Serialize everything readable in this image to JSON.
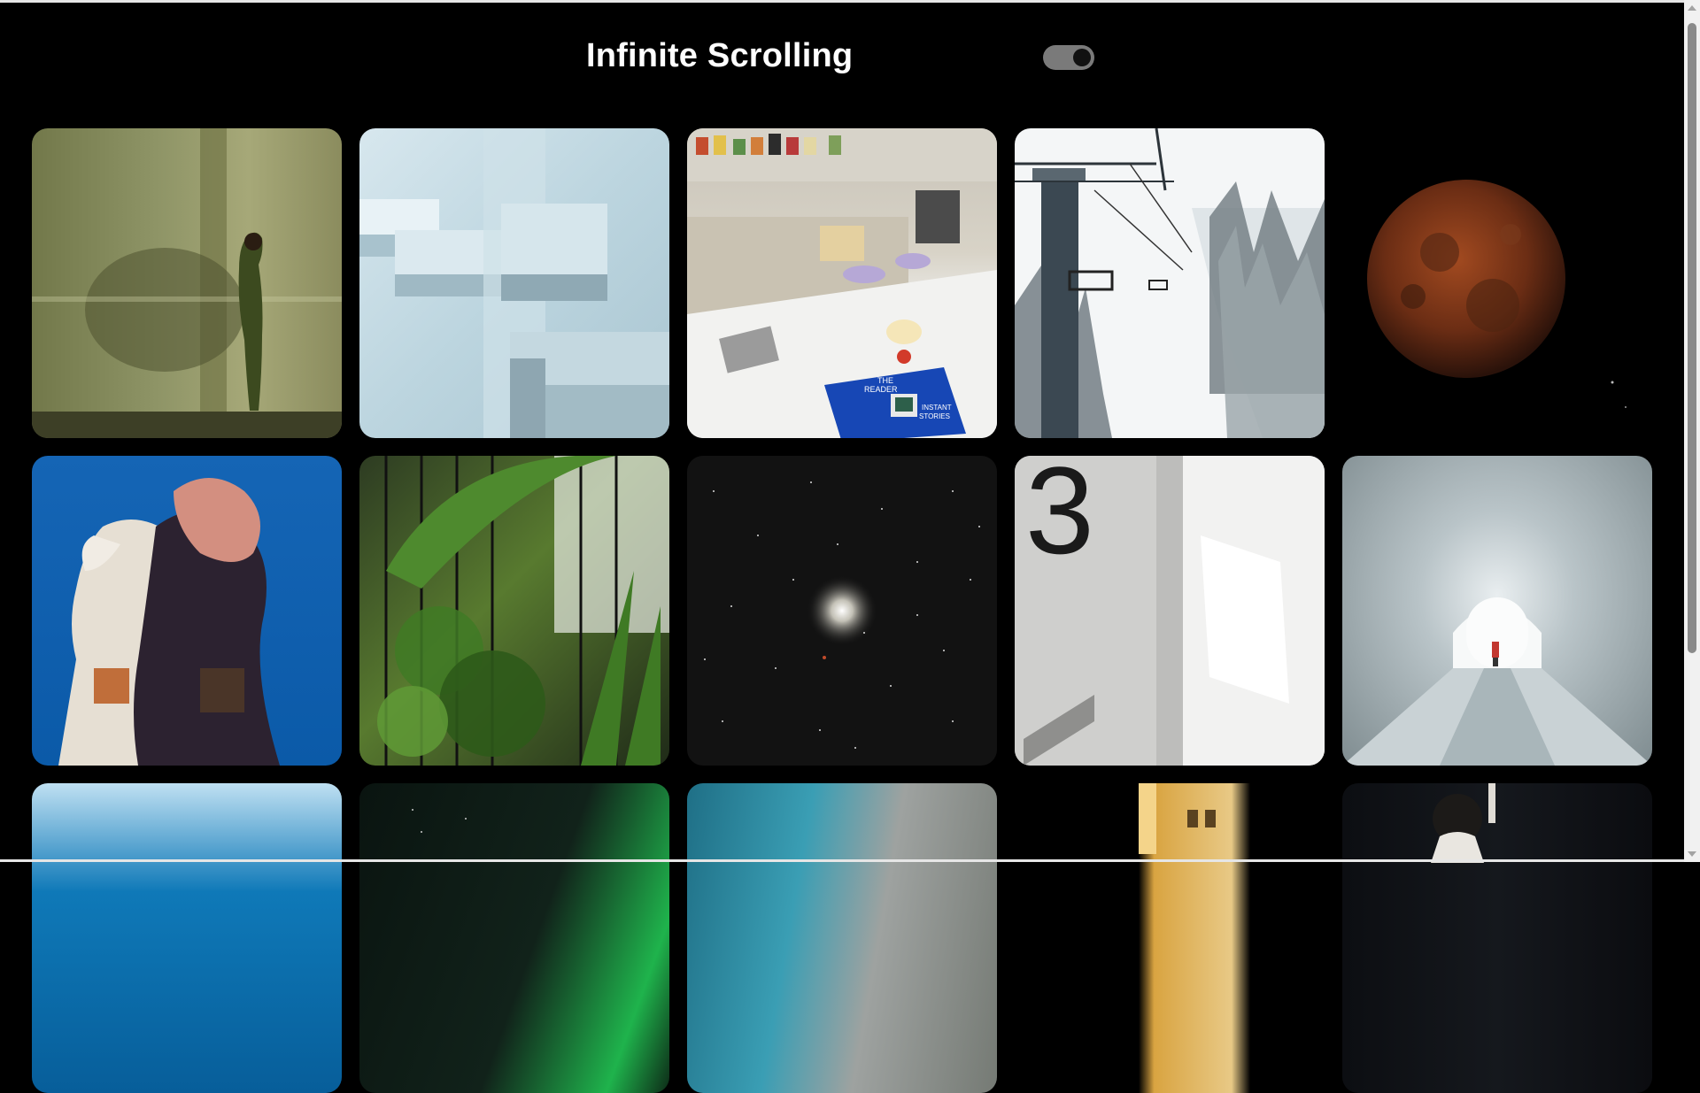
{
  "header": {
    "title": "Infinite Scrolling",
    "toggle_state": "on"
  },
  "gallery": {
    "columns": 5,
    "tiles": [
      {
        "subject": "woman-against-wall"
      },
      {
        "subject": "abstract-blue-architecture"
      },
      {
        "subject": "kitchen-counter-book"
      },
      {
        "subject": "ski-lift-snow-forest"
      },
      {
        "subject": "blood-moon"
      },
      {
        "subject": "person-with-horse"
      },
      {
        "subject": "tropical-plants-fence"
      },
      {
        "subject": "star-cluster"
      },
      {
        "subject": "wall-number-three"
      },
      {
        "subject": "tunnel-hallway"
      },
      {
        "subject": "ocean-horizon"
      },
      {
        "subject": "aurora-night-sky"
      },
      {
        "subject": "aerial-coastline"
      },
      {
        "subject": "theatre-marquee-night"
      },
      {
        "subject": "woman-portrait-dark"
      }
    ],
    "tile3_book_text": [
      "THE",
      "READER",
      "INSTANT",
      "STORIES"
    ],
    "tile9_number": "3"
  },
  "scrollbar": {
    "position": 0.0
  },
  "colors": {
    "background": "#000000",
    "title": "#ffffff",
    "toggle_track": "#7a7a7a",
    "toggle_knob": "#111111"
  }
}
